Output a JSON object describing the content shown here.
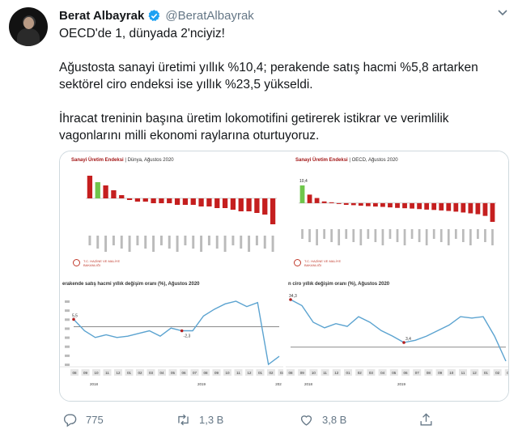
{
  "user": {
    "name": "Berat Albayrak",
    "handle": "@BeratAlbayrak"
  },
  "tweet": {
    "line1": "OECD'de 1, dünyada 2'nciyiz!",
    "line2": "Ağustosta sanayi üretimi yıllık %10,4; perakende satış hacmi %5,8 artarken",
    "line3": "sektörel ciro endeksi ise yıllık %23,5 yükseldi.",
    "line4": "İhracat treninin başına üretim lokomotifini getirerek istikrar ve verimlilik",
    "line5": "vagonlarını milli ekonomi raylarına oturtuyoruz."
  },
  "media": {
    "top_left": {
      "title_bold": "Sanayi Üretim Endeksi",
      "title_rest": "| Dünya, Ağustos 2020",
      "values": [
        14,
        10,
        8,
        5,
        2,
        -1,
        -2,
        -2,
        -3,
        -3,
        -3,
        -4,
        -4,
        -4,
        -5,
        -5,
        -6,
        -6,
        -7,
        -8,
        -8,
        -9,
        -10,
        -16
      ]
    },
    "top_right": {
      "title_bold": "Sanayi Üretim Endeksi",
      "title_rest": "| OECD, Ağustos 2020",
      "highlight_label": "10,4",
      "values": [
        10.4,
        5,
        3,
        1,
        0.5,
        -0.5,
        -1,
        -1.2,
        -1.5,
        -1.8,
        -2,
        -2.2,
        -2.5,
        -2.8,
        -3,
        -3.2,
        -3.5,
        -3.8,
        -4,
        -4.3,
        -4.6,
        -5,
        -5.5,
        -6,
        -6.5,
        -7.5,
        -11
      ]
    },
    "bottom_left": {
      "title": "erakende satış hacmi yıllık değişim oranı (%), Ağustos 2020",
      "start_label": "5,5",
      "mid_label": "-2,3",
      "values": [
        5.5,
        -3,
        -8,
        -6,
        -8,
        -7,
        -5,
        -3,
        -7,
        -1,
        -3,
        -3,
        8,
        13,
        17,
        19,
        15,
        18,
        -28,
        -22
      ],
      "months": [
        "08",
        "09",
        "10",
        "11",
        "12",
        "01",
        "02",
        "03",
        "04",
        "05",
        "06",
        "07",
        "08",
        "09",
        "10",
        "11",
        "12",
        "01",
        "02",
        "03"
      ],
      "years": [
        "2018",
        "2019",
        "202"
      ]
    },
    "bottom_right": {
      "title": "n ciro yıllık değişim oranı (%), Ağustos 2020",
      "start_label": "34,3",
      "mid_label": "3,4",
      "values": [
        34.3,
        30,
        18,
        14,
        17,
        15,
        22,
        18,
        12,
        8,
        3.4,
        5,
        8,
        12,
        16,
        22,
        21,
        22,
        8,
        -10
      ],
      "months": [
        "08",
        "09",
        "10",
        "11",
        "12",
        "01",
        "02",
        "03",
        "04",
        "05",
        "06",
        "07",
        "08",
        "09",
        "10",
        "11",
        "12",
        "01",
        "02",
        "03"
      ],
      "years": [
        "2018",
        "2019"
      ]
    },
    "footer_logo": "T.C. HAZİNE VE MALİYE BAKANLIĞI"
  },
  "actions": {
    "reply_count": "775",
    "retweet_count": "1,3 B",
    "like_count": "3,8 B"
  },
  "colors": {
    "accent": "#1da1f2",
    "red_bar": "#c51f1f",
    "green_bar": "#6fc64b",
    "line": "#5ba3d0"
  }
}
